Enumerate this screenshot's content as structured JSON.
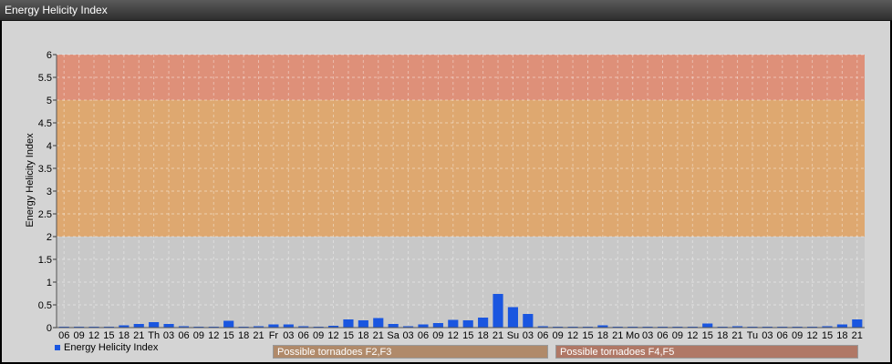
{
  "window": {
    "title": "Energy Helicity Index"
  },
  "colors": {
    "bar": "#1a56e0",
    "band_f2f3": "#e0a466",
    "band_f4f5": "#e08a70",
    "band_low": "#c8c8c8",
    "legend_f2f3": "#b08a6a",
    "legend_f4f5": "#b07866"
  },
  "legend": {
    "series_label": "Energy Helicity Index",
    "band1_label": "Possible tornadoes F2,F3",
    "band2_label": "Possible tornadoes F4,F5"
  },
  "chart_data": {
    "type": "bar",
    "title": "",
    "xlabel": "",
    "ylabel": "Energy Helicity Index",
    "ylim": [
      0,
      6
    ],
    "yticks": [
      "0",
      "0.5",
      "1",
      "1.5",
      "2",
      "2.5",
      "3",
      "3.5",
      "4",
      "4.5",
      "5",
      "5.5",
      "6"
    ],
    "grid": true,
    "bands": [
      {
        "from": 2,
        "to": 5,
        "label": "Possible tornadoes F2,F3"
      },
      {
        "from": 5,
        "to": 6,
        "label": "Possible tornadoes F4,F5"
      }
    ],
    "categories": [
      "06",
      "09",
      "12",
      "15",
      "18",
      "21",
      "Th",
      "03",
      "06",
      "09",
      "12",
      "15",
      "18",
      "21",
      "Fr",
      "03",
      "06",
      "09",
      "12",
      "15",
      "18",
      "21",
      "Sa",
      "03",
      "06",
      "09",
      "12",
      "15",
      "18",
      "21",
      "Su",
      "03",
      "06",
      "09",
      "12",
      "15",
      "18",
      "21",
      "Mo",
      "03",
      "06",
      "09",
      "12",
      "15",
      "18",
      "21",
      "Tu",
      "03",
      "06",
      "09",
      "12",
      "15",
      "18",
      "21"
    ],
    "series": [
      {
        "name": "Energy Helicity Index",
        "values": [
          0.02,
          0.02,
          0.02,
          0.02,
          0.05,
          0.08,
          0.12,
          0.08,
          0.03,
          0.02,
          0.02,
          0.15,
          0.02,
          0.03,
          0.07,
          0.07,
          0.03,
          0.02,
          0.04,
          0.18,
          0.16,
          0.21,
          0.08,
          0.03,
          0.07,
          0.1,
          0.17,
          0.16,
          0.22,
          0.74,
          0.45,
          0.3,
          0.03,
          0.02,
          0.02,
          0.02,
          0.05,
          0.02,
          0.02,
          0.02,
          0.02,
          0.02,
          0.02,
          0.09,
          0.02,
          0.03,
          0.02,
          0.02,
          0.02,
          0.02,
          0.02,
          0.03,
          0.07,
          0.18
        ]
      }
    ]
  }
}
